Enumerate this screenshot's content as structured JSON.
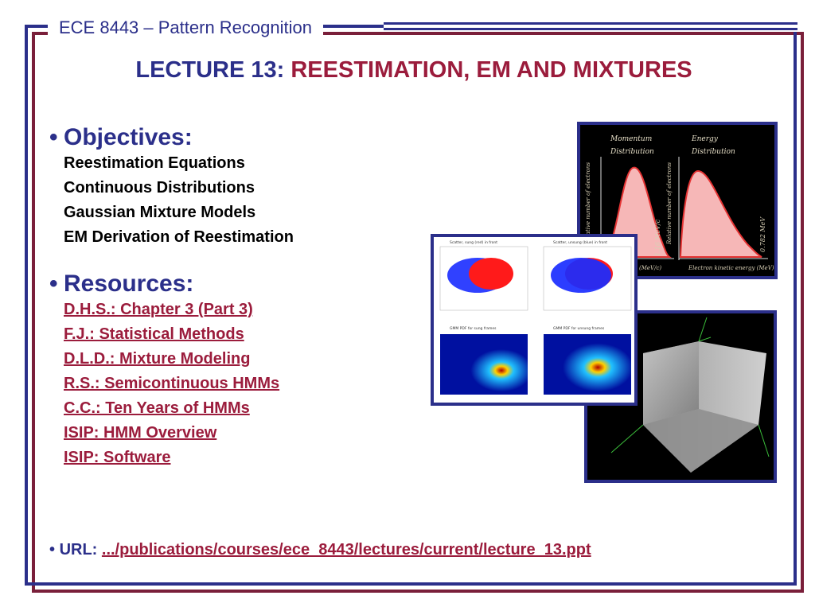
{
  "header": {
    "course": "ECE 8443 – Pattern Recognition",
    "lecture_label": "LECTURE 13:",
    "lecture_topic": "REESTIMATION, EM AND MIXTURES"
  },
  "objectives": {
    "heading": "Objectives:",
    "items": [
      "Reestimation Equations",
      "Continuous Distributions",
      "Gaussian Mixture Models",
      "EM Derivation of Reestimation"
    ]
  },
  "resources": {
    "heading": "Resources:",
    "links": [
      "D.H.S.: Chapter 3 (Part 3)",
      "F.J.: Statistical Methods",
      "D.L.D.: Mixture Modeling",
      "R.S.: Semicontinuous HMMs",
      "C.C.: Ten Years of HMMs",
      "ISIP: HMM Overview",
      "ISIP: Software"
    ]
  },
  "footer": {
    "url_label": "URL:",
    "url_text": ".../publications/courses/ece_8443/lectures/current/lecture_13.ppt"
  },
  "figures": {
    "energy": {
      "label_left_1": "Momentum",
      "label_left_2": "Distribution",
      "label_right_1": "Energy",
      "label_right_2": "Distribution",
      "ylabel_left": "Relative number of electrons",
      "ylabel_right": "Relative number of electrons",
      "annot_left": "1.16 MeV/c",
      "annot_right": "0.782 MeV",
      "xlabel_left": "(MeV/c)",
      "xlabel_right": "Electron kinetic energy (MeV)"
    },
    "scatter": {
      "title_tl": "Scatter, sung (red) in front",
      "title_tr": "Scatter, unsung (blue) in front",
      "title_bl": "GMM PDF for sung frames",
      "title_br": "GMM PDF for unsung frames"
    }
  },
  "colors": {
    "blue": "#2b2f8a",
    "red": "#9b1c3c"
  }
}
